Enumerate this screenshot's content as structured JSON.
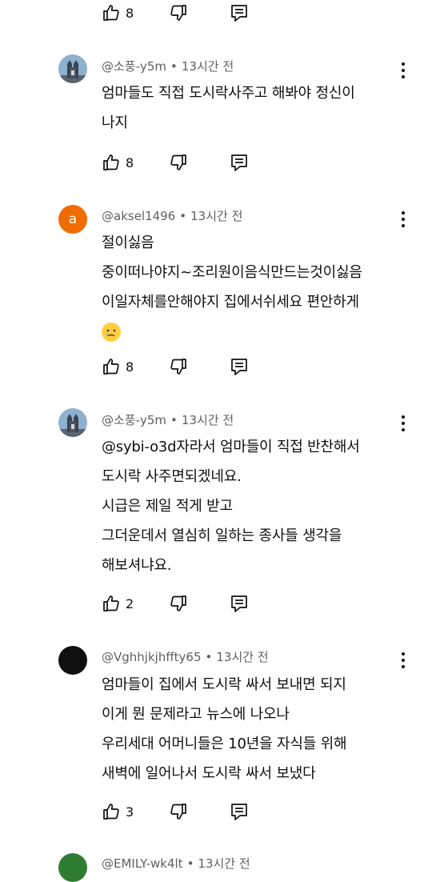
{
  "top_actions": {
    "like_count": "8"
  },
  "comments": [
    {
      "author": "@소풍-y5m",
      "time": "13시간 전",
      "lines": [
        "엄마들도 직접 도시락사주고 해봐야 정신이",
        "나지"
      ],
      "like_count": "8",
      "avatar": {
        "type": "image",
        "icon": "cathedral-avatar"
      }
    },
    {
      "author": "@aksel1496",
      "time": "13시간 전",
      "lines": [
        "절이싫음",
        "중이떠나야지~조리원이음식만드는것이싫음",
        "이일자체를안해야지 집에서쉬세요 편안하게"
      ],
      "has_emoji": true,
      "like_count": "8",
      "avatar": {
        "type": "letter",
        "letter": "a",
        "color": "#ef6c00"
      }
    },
    {
      "author": "@소풍-y5m",
      "time": "13시간 전",
      "lines": [
        "@sybi-o3d자라서 엄마들이 직접 반찬해서",
        "도시락 사주면되겠네요.",
        "시급은 제일 적게 받고",
        "그더운데서 열심히 일하는 종사들 생각을",
        "해보셔냐요."
      ],
      "like_count": "2",
      "avatar": {
        "type": "image",
        "icon": "cathedral-avatar"
      }
    },
    {
      "author": "@Vghhjkjhffty65",
      "time": "13시간 전",
      "lines": [
        "엄마들이  집에서 도시락 싸서 보내면 되지",
        "이게 뭔 문제라고 뉴스에 나오나",
        "우리세대 어머니들은 10년을 자식들 위해",
        "새벽에 일어나서 도시락 싸서 보냈다"
      ],
      "like_count": "3",
      "avatar": {
        "type": "solid",
        "color": "#0f0f0f"
      }
    },
    {
      "author": "@EMILY-wk4lt",
      "time": "13시간 전",
      "avatar": {
        "type": "solid",
        "color": "#2e7d32"
      }
    }
  ],
  "colors": {
    "text": "#0f0f0f",
    "meta": "#606060",
    "background": "#ffffff"
  }
}
